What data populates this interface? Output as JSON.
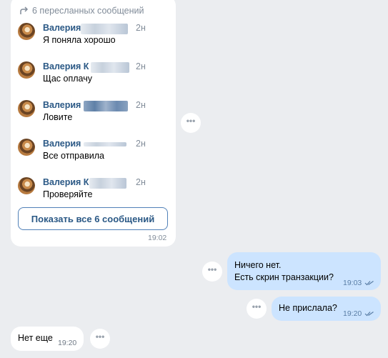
{
  "forwarded": {
    "header": "6 пересланных сообщений",
    "messages": [
      {
        "name": "Валерия",
        "time": "2н",
        "text": "Я поняла хорошо"
      },
      {
        "name": "Валерия К",
        "time": "2н",
        "text": "Щас оплачу"
      },
      {
        "name": "Валерия",
        "time": "2н",
        "text": "Ловите"
      },
      {
        "name": "Валерия",
        "time": "2н",
        "text": "Все отправила"
      },
      {
        "name": "Валерия К",
        "time": "2н",
        "text": "Проверяйте"
      }
    ],
    "show_all_label": "Показать все 6 сообщений",
    "time": "19:02"
  },
  "messages": [
    {
      "direction": "out",
      "lines": [
        "Ничего нет.",
        "Есть скрин транзакции?"
      ],
      "time": "19:03"
    },
    {
      "direction": "out",
      "lines": [
        "Не прислала?"
      ],
      "time": "19:20"
    },
    {
      "direction": "in",
      "lines": [
        "Нет еще"
      ],
      "time": "19:20"
    }
  ],
  "more_icon": "ellipsis-icon",
  "colors": {
    "background": "#ebedf0",
    "outgoing_bubble": "#cce4ff",
    "incoming_bubble": "#ffffff",
    "link": "#2a5885",
    "muted": "#818c99"
  }
}
